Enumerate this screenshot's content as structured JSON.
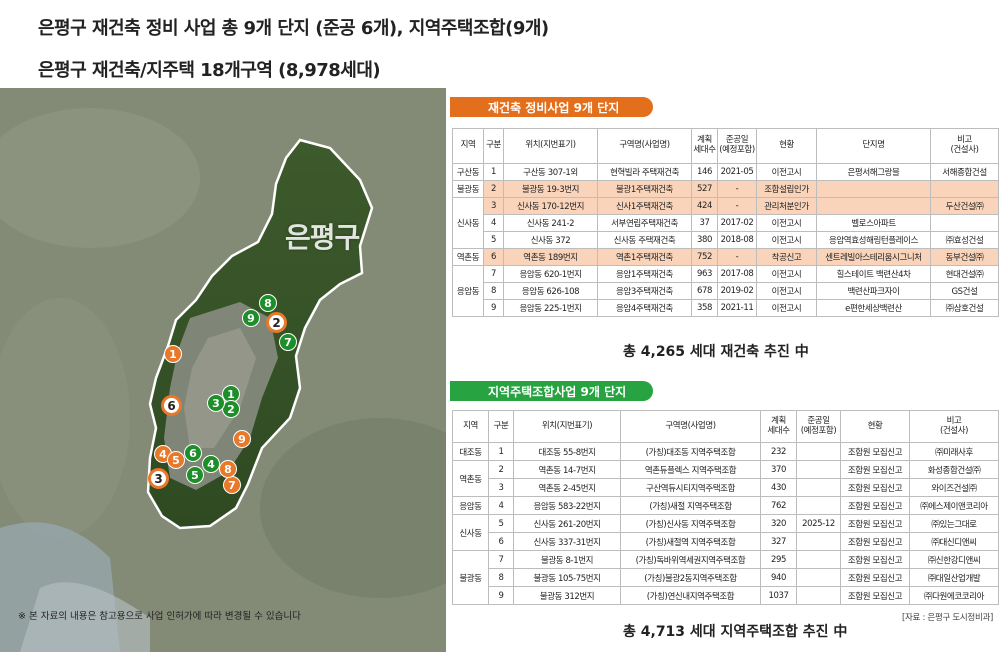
{
  "header": {
    "title_line1": "은평구 재건축 정비 사업 총 9개 단지 (준공 6개), 지역주택조합(9개)",
    "title_line2": "은평구 재건축/지주택 18개구역 (8,978세대)"
  },
  "map": {
    "district_label": "은평구",
    "note": "※ 본 자료의 내용은 참고용으로 사업 인허가에 따라 변경될 수 있습니다",
    "markers": [
      {
        "label": "1",
        "style": "orange"
      },
      {
        "label": "2",
        "style": "ring"
      },
      {
        "label": "3",
        "style": "ring"
      },
      {
        "label": "4",
        "style": "orange"
      },
      {
        "label": "5",
        "style": "orange"
      },
      {
        "label": "6",
        "style": "ring"
      },
      {
        "label": "7",
        "style": "orange"
      },
      {
        "label": "8",
        "style": "orange"
      },
      {
        "label": "9",
        "style": "orange"
      },
      {
        "label": "1",
        "style": "green"
      },
      {
        "label": "2",
        "style": "green"
      },
      {
        "label": "3",
        "style": "green"
      },
      {
        "label": "4",
        "style": "green"
      },
      {
        "label": "5",
        "style": "green"
      },
      {
        "label": "6",
        "style": "green"
      },
      {
        "label": "7",
        "style": "green"
      },
      {
        "label": "8",
        "style": "green"
      },
      {
        "label": "9",
        "style": "green"
      }
    ],
    "colors": {
      "orange": "#e8782a",
      "green": "#1e8e2a"
    }
  },
  "reconstruction": {
    "banner": "재건축 정비사업 9개 단지",
    "headers": [
      "지역",
      "구분",
      "위치(지번표기)",
      "구역명(사업명)",
      "계획\n세대수",
      "준공일\n(예정포함)",
      "현황",
      "단지명",
      "비고\n(건설사)"
    ],
    "regions": [
      {
        "name": "구산동",
        "rows": 1
      },
      {
        "name": "불광동",
        "rows": 1
      },
      {
        "name": "신사동",
        "rows": 3
      },
      {
        "name": "역촌동",
        "rows": 1
      },
      {
        "name": "응암동",
        "rows": 3
      }
    ],
    "rows": [
      {
        "no": "1",
        "location": "구산동 307-1외",
        "project": "현혁빌라 주택재건축",
        "units": "146",
        "completion": "2021-05",
        "status": "이전고시",
        "complex": "은평서해그랑블",
        "builder": "서해종합건설",
        "highlight": false
      },
      {
        "no": "2",
        "location": "불광동 19-3번지",
        "project": "불광1주택재건축",
        "units": "527",
        "completion": "-",
        "status": "조합설립인가",
        "complex": "",
        "builder": "",
        "highlight": true
      },
      {
        "no": "3",
        "location": "신사동 170-12번지",
        "project": "신사1주택재건축",
        "units": "424",
        "completion": "-",
        "status": "관리처분인가",
        "complex": "",
        "builder": "두산건설㈜",
        "highlight": true
      },
      {
        "no": "4",
        "location": "신사동 241-2",
        "project": "서부연립주택재건축",
        "units": "37",
        "completion": "2017-02",
        "status": "이전고시",
        "complex": "벨로스아파트",
        "builder": "",
        "highlight": false
      },
      {
        "no": "5",
        "location": "신사동 372",
        "project": "신사동 주택재건축",
        "units": "380",
        "completion": "2018-08",
        "status": "이전고시",
        "complex": "응암역효성해링턴플레이스",
        "builder": "㈜효성건설",
        "highlight": false
      },
      {
        "no": "6",
        "location": "역촌동 189번지",
        "project": "역촌1주택재건축",
        "units": "752",
        "completion": "-",
        "status": "착공신고",
        "complex": "센트레빌아스테리움시그니처",
        "builder": "동부건설㈜",
        "highlight": true
      },
      {
        "no": "7",
        "location": "응암동 620-1번지",
        "project": "응암1주택재건축",
        "units": "963",
        "completion": "2017-08",
        "status": "이전고시",
        "complex": "힐스테이트 백련산4차",
        "builder": "현대건설㈜",
        "highlight": false
      },
      {
        "no": "8",
        "location": "응암동 626-108",
        "project": "응암3주택재건축",
        "units": "678",
        "completion": "2019-02",
        "status": "이전고시",
        "complex": "백련산파크자이",
        "builder": "GS건설",
        "highlight": false
      },
      {
        "no": "9",
        "location": "응암동 225-1번지",
        "project": "응암4주택재건축",
        "units": "358",
        "completion": "2021-11",
        "status": "이전고시",
        "complex": "e편한세상백련산",
        "builder": "㈜삼호건설",
        "highlight": false
      }
    ],
    "summary": "총 4,265 세대 재건축 추진 中"
  },
  "housing": {
    "banner": "지역주택조합사업 9개 단지",
    "headers": [
      "지역",
      "구분",
      "위치(지번표기)",
      "구역명(사업명)",
      "계획\n세대수",
      "준공일\n(예정포함)",
      "현황",
      "비고\n(건설사)"
    ],
    "regions": [
      {
        "name": "대조동",
        "rows": 1
      },
      {
        "name": "역촌동",
        "rows": 2
      },
      {
        "name": "응암동",
        "rows": 1
      },
      {
        "name": "신사동",
        "rows": 2
      },
      {
        "name": "불광동",
        "rows": 3
      }
    ],
    "rows": [
      {
        "no": "1",
        "location": "대조동 55-8번지",
        "project": "(가칭)대조동 지역주택조합",
        "units": "232",
        "completion": "",
        "status": "조합원 모집신고",
        "builder": "㈜미래사후"
      },
      {
        "no": "2",
        "location": "역촌동 14-7번지",
        "project": "역촌듀플렉스 지역주택조합",
        "units": "370",
        "completion": "",
        "status": "조합원 모집신고",
        "builder": "화성종합건설㈜"
      },
      {
        "no": "3",
        "location": "역촌동 2-45번지",
        "project": "구산역듀시티지역주택조합",
        "units": "430",
        "completion": "",
        "status": "조합원 모집신고",
        "builder": "와이즈건설㈜"
      },
      {
        "no": "4",
        "location": "응암동 583-22번지",
        "project": "(가칭)새절 지역주택조합",
        "units": "762",
        "completion": "",
        "status": "조합원 모집신고",
        "builder": "㈜에스제이앤코리아"
      },
      {
        "no": "5",
        "location": "신사동 261-20번지",
        "project": "(가칭)신사동 지역주택조합",
        "units": "320",
        "completion": "2025-12",
        "status": "조합원 모집신고",
        "builder": "㈜있는그대로"
      },
      {
        "no": "6",
        "location": "신사동 337-31번지",
        "project": "(가칭)새절역 지역주택조합",
        "units": "327",
        "completion": "",
        "status": "조합원 모집신고",
        "builder": "㈜대신디앤씨"
      },
      {
        "no": "7",
        "location": "불광동 8-1번지",
        "project": "(가칭)독바위역세권지역주택조합",
        "units": "295",
        "completion": "",
        "status": "조합원 모집신고",
        "builder": "㈜신한강디앤씨"
      },
      {
        "no": "8",
        "location": "불광동 105-75번지",
        "project": "(가칭)불광2동지역주택조합",
        "units": "940",
        "completion": "",
        "status": "조합원 모집신고",
        "builder": "㈜대일산업개발"
      },
      {
        "no": "9",
        "location": "불광동 312번지",
        "project": "(가칭)연신내지역주택조합",
        "units": "1037",
        "completion": "",
        "status": "조합원 모집신고",
        "builder": "㈜다원에코코리아"
      }
    ],
    "summary": "총 4,713 세대 지역주택조합 추진 中",
    "source": "[자료 : 은평구 도시정비과]"
  }
}
